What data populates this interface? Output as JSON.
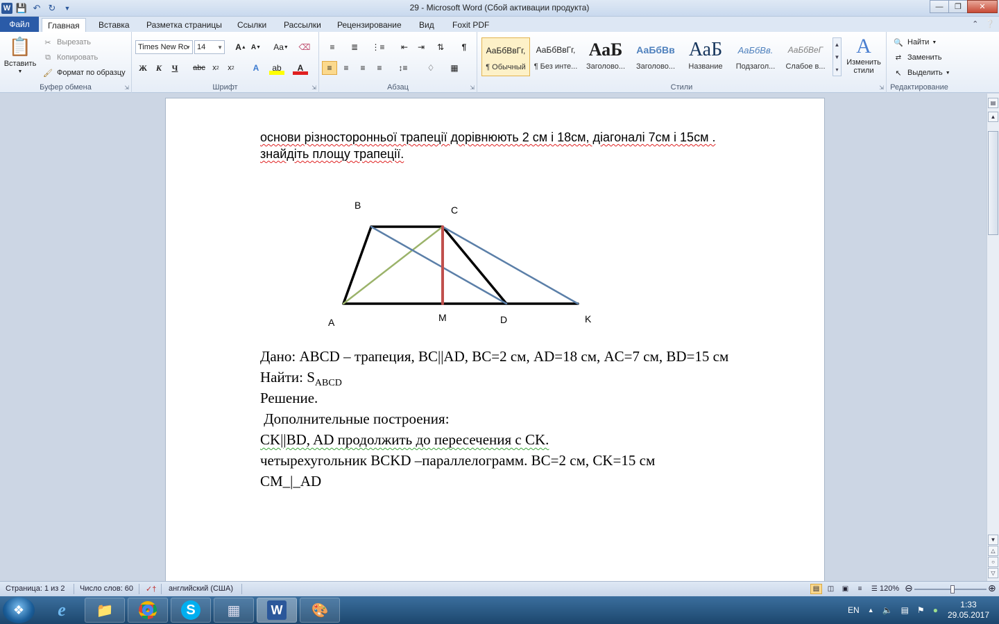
{
  "window": {
    "title": "29  -  Microsoft Word (Сбой активации продукта)",
    "app_icon": "W"
  },
  "tabs": [
    {
      "label": "Файл"
    },
    {
      "label": "Главная"
    },
    {
      "label": "Вставка"
    },
    {
      "label": "Разметка страницы"
    },
    {
      "label": "Ссылки"
    },
    {
      "label": "Рассылки"
    },
    {
      "label": "Рецензирование"
    },
    {
      "label": "Вид"
    },
    {
      "label": "Foxit PDF"
    }
  ],
  "clipboard": {
    "paste": "Вставить",
    "cut": "Вырезать",
    "copy": "Копировать",
    "format_painter": "Формат по образцу",
    "label": "Буфер обмена"
  },
  "font": {
    "name": "Times New Rc",
    "size": "14",
    "label": "Шрифт"
  },
  "paragraph": {
    "label": "Абзац"
  },
  "styles": {
    "label": "Стили",
    "items": [
      {
        "preview": "АаБбВвГг,",
        "name": "¶ Обычный"
      },
      {
        "preview": "АаБбВвГг,",
        "name": "¶ Без инте..."
      },
      {
        "preview": "АаБ",
        "name": "Заголово..."
      },
      {
        "preview": "АаБбВв",
        "name": "Заголово..."
      },
      {
        "preview": "АаБ",
        "name": "Название"
      },
      {
        "preview": "АаБбВв.",
        "name": "Подзагол..."
      },
      {
        "preview": "АаБбВеГ",
        "name": "Слабое в..."
      }
    ],
    "change_styles": "Изменить стили"
  },
  "editing": {
    "label": "Редактирование",
    "find": "Найти",
    "replace": "Заменить",
    "select": "Выделить"
  },
  "document": {
    "line1": "основи різносторонньої трапеції дорівнюють 2 см і 18см, діагоналі 7см і 15см .",
    "line2": "знайдіть площу трапеції.",
    "labels": {
      "A": "A",
      "B": "B",
      "C": "C",
      "D": "D",
      "M": "M",
      "K": "K"
    },
    "given": "Дано: ABCD – трапеция,  BC||AD, BC=2 см, AD=18 см, AC=7 см, BD=15 см",
    "find_prefix": "Найти: S",
    "find_sub": "ABCD",
    "solution": "Решение.",
    "extra": " Дополнительные построения:",
    "step1": "CK||BD, AD продолжить до пересечения с CK.",
    "step2": "четырехугольник  BCKD –параллелограмм. BC=2 см, CK=15 см",
    "step3": "CM_|_AD",
    "colors": {
      "black": "#000000",
      "blue": "#5b7fa8",
      "green": "#9bb36a",
      "red": "#c0504d"
    }
  },
  "status": {
    "page": "Страница: 1 из 2",
    "words": "Число слов: 60",
    "language": "английский (США)",
    "zoom": "120%"
  },
  "tray": {
    "lang": "EN",
    "time": "1:33",
    "date": "29.05.2017"
  }
}
